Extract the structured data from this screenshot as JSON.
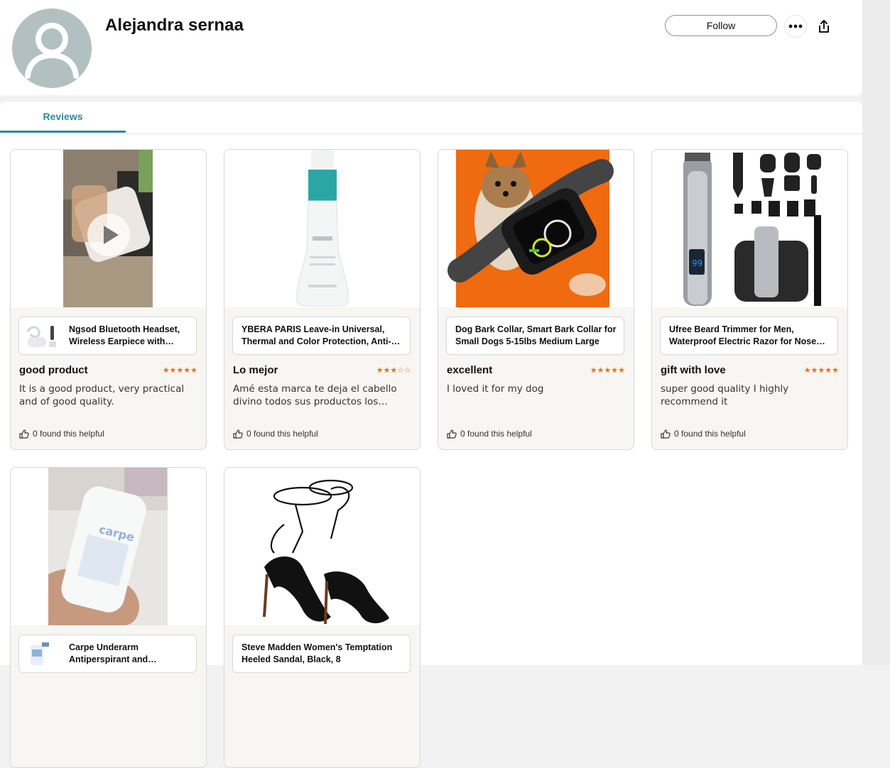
{
  "profile": {
    "name": "Alejandra sernaa",
    "follow_label": "Follow"
  },
  "tabs": [
    {
      "label": "Reviews"
    }
  ],
  "reviews": [
    {
      "product": "Ngsod Bluetooth Headset, Wireless Earpiece with Microphone",
      "title": "good product",
      "rating": 5,
      "stars": "★★★★★",
      "body": "It is a good product, very practical and of good quality.",
      "helpful": "0 found this helpful"
    },
    {
      "product": "YBERA PARIS Leave-in Universal, Thermal and Color Protection, Anti-Frizz",
      "title": "Lo mejor",
      "rating": 3,
      "stars": "★★★☆☆",
      "body": "Amé esta marca te deja el cabello divino todos sus productos los recomiendo",
      "helpful": "0 found this helpful"
    },
    {
      "product": "Dog Bark Collar, Smart Bark Collar for Small Dogs 5-15lbs Medium Large",
      "title": "excellent",
      "rating": 5,
      "stars": "★★★★★",
      "body": "I loved it for my dog",
      "helpful": "0 found this helpful"
    },
    {
      "product": "Ufree Beard Trimmer for Men, Waterproof Electric Razor for Nose Hair",
      "title": "gift with love",
      "rating": 5,
      "stars": "★★★★★",
      "body": "super good quality I highly recommend it",
      "helpful": "0 found this helpful"
    },
    {
      "product": "Carpe Underarm Antiperspirant and Deodorant",
      "title": "",
      "rating": null,
      "stars": "",
      "body": "",
      "helpful": ""
    },
    {
      "product": "Steve Madden Women's Temptation Heeled Sandal, Black, 8",
      "title": "",
      "rating": null,
      "stars": "",
      "body": "",
      "helpful": ""
    }
  ],
  "colors": {
    "accent": "#2c8a9b",
    "star": "#ff6a00",
    "avatar_bg": "#b3c0c2"
  },
  "icons": [
    "user-avatar-icon",
    "more-options-icon",
    "share-icon",
    "thumbs-up-icon",
    "play-icon"
  ]
}
